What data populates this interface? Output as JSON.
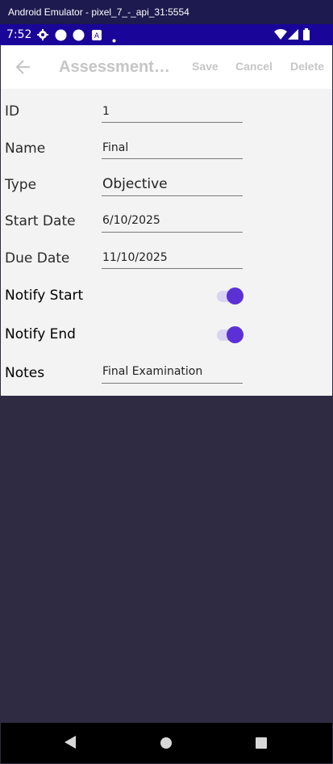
{
  "emulator": {
    "title": "Android Emulator - pixel_7_-_api_31:5554"
  },
  "status_bar": {
    "time": "7:52"
  },
  "toolbar": {
    "title": "AssessmentE...",
    "save_label": "Save",
    "cancel_label": "Cancel",
    "delete_label": "Delete"
  },
  "form": {
    "id_label": "ID",
    "id_value": "1",
    "name_label": "Name",
    "name_value": "Final",
    "type_label": "Type",
    "type_value": "Objective",
    "start_label": "Start Date",
    "start_value": "6/10/2025",
    "due_label": "Due Date",
    "due_value": "11/10/2025",
    "notify_start_label": "Notify Start",
    "notify_start_on": true,
    "notify_end_label": "Notify End",
    "notify_end_on": true,
    "notes_label": "Notes",
    "notes_value": "Final Examination"
  },
  "colors": {
    "accent": "#5b31d6",
    "status_bar": "#1a0599",
    "background": "#2e2b42"
  },
  "icons": [
    "back-arrow-icon",
    "gear-icon",
    "circle-icon",
    "sim-icon",
    "dot-icon",
    "wifi-icon",
    "signal-icon",
    "battery-icon",
    "nav-back-icon",
    "nav-home-icon",
    "nav-recents-icon"
  ]
}
